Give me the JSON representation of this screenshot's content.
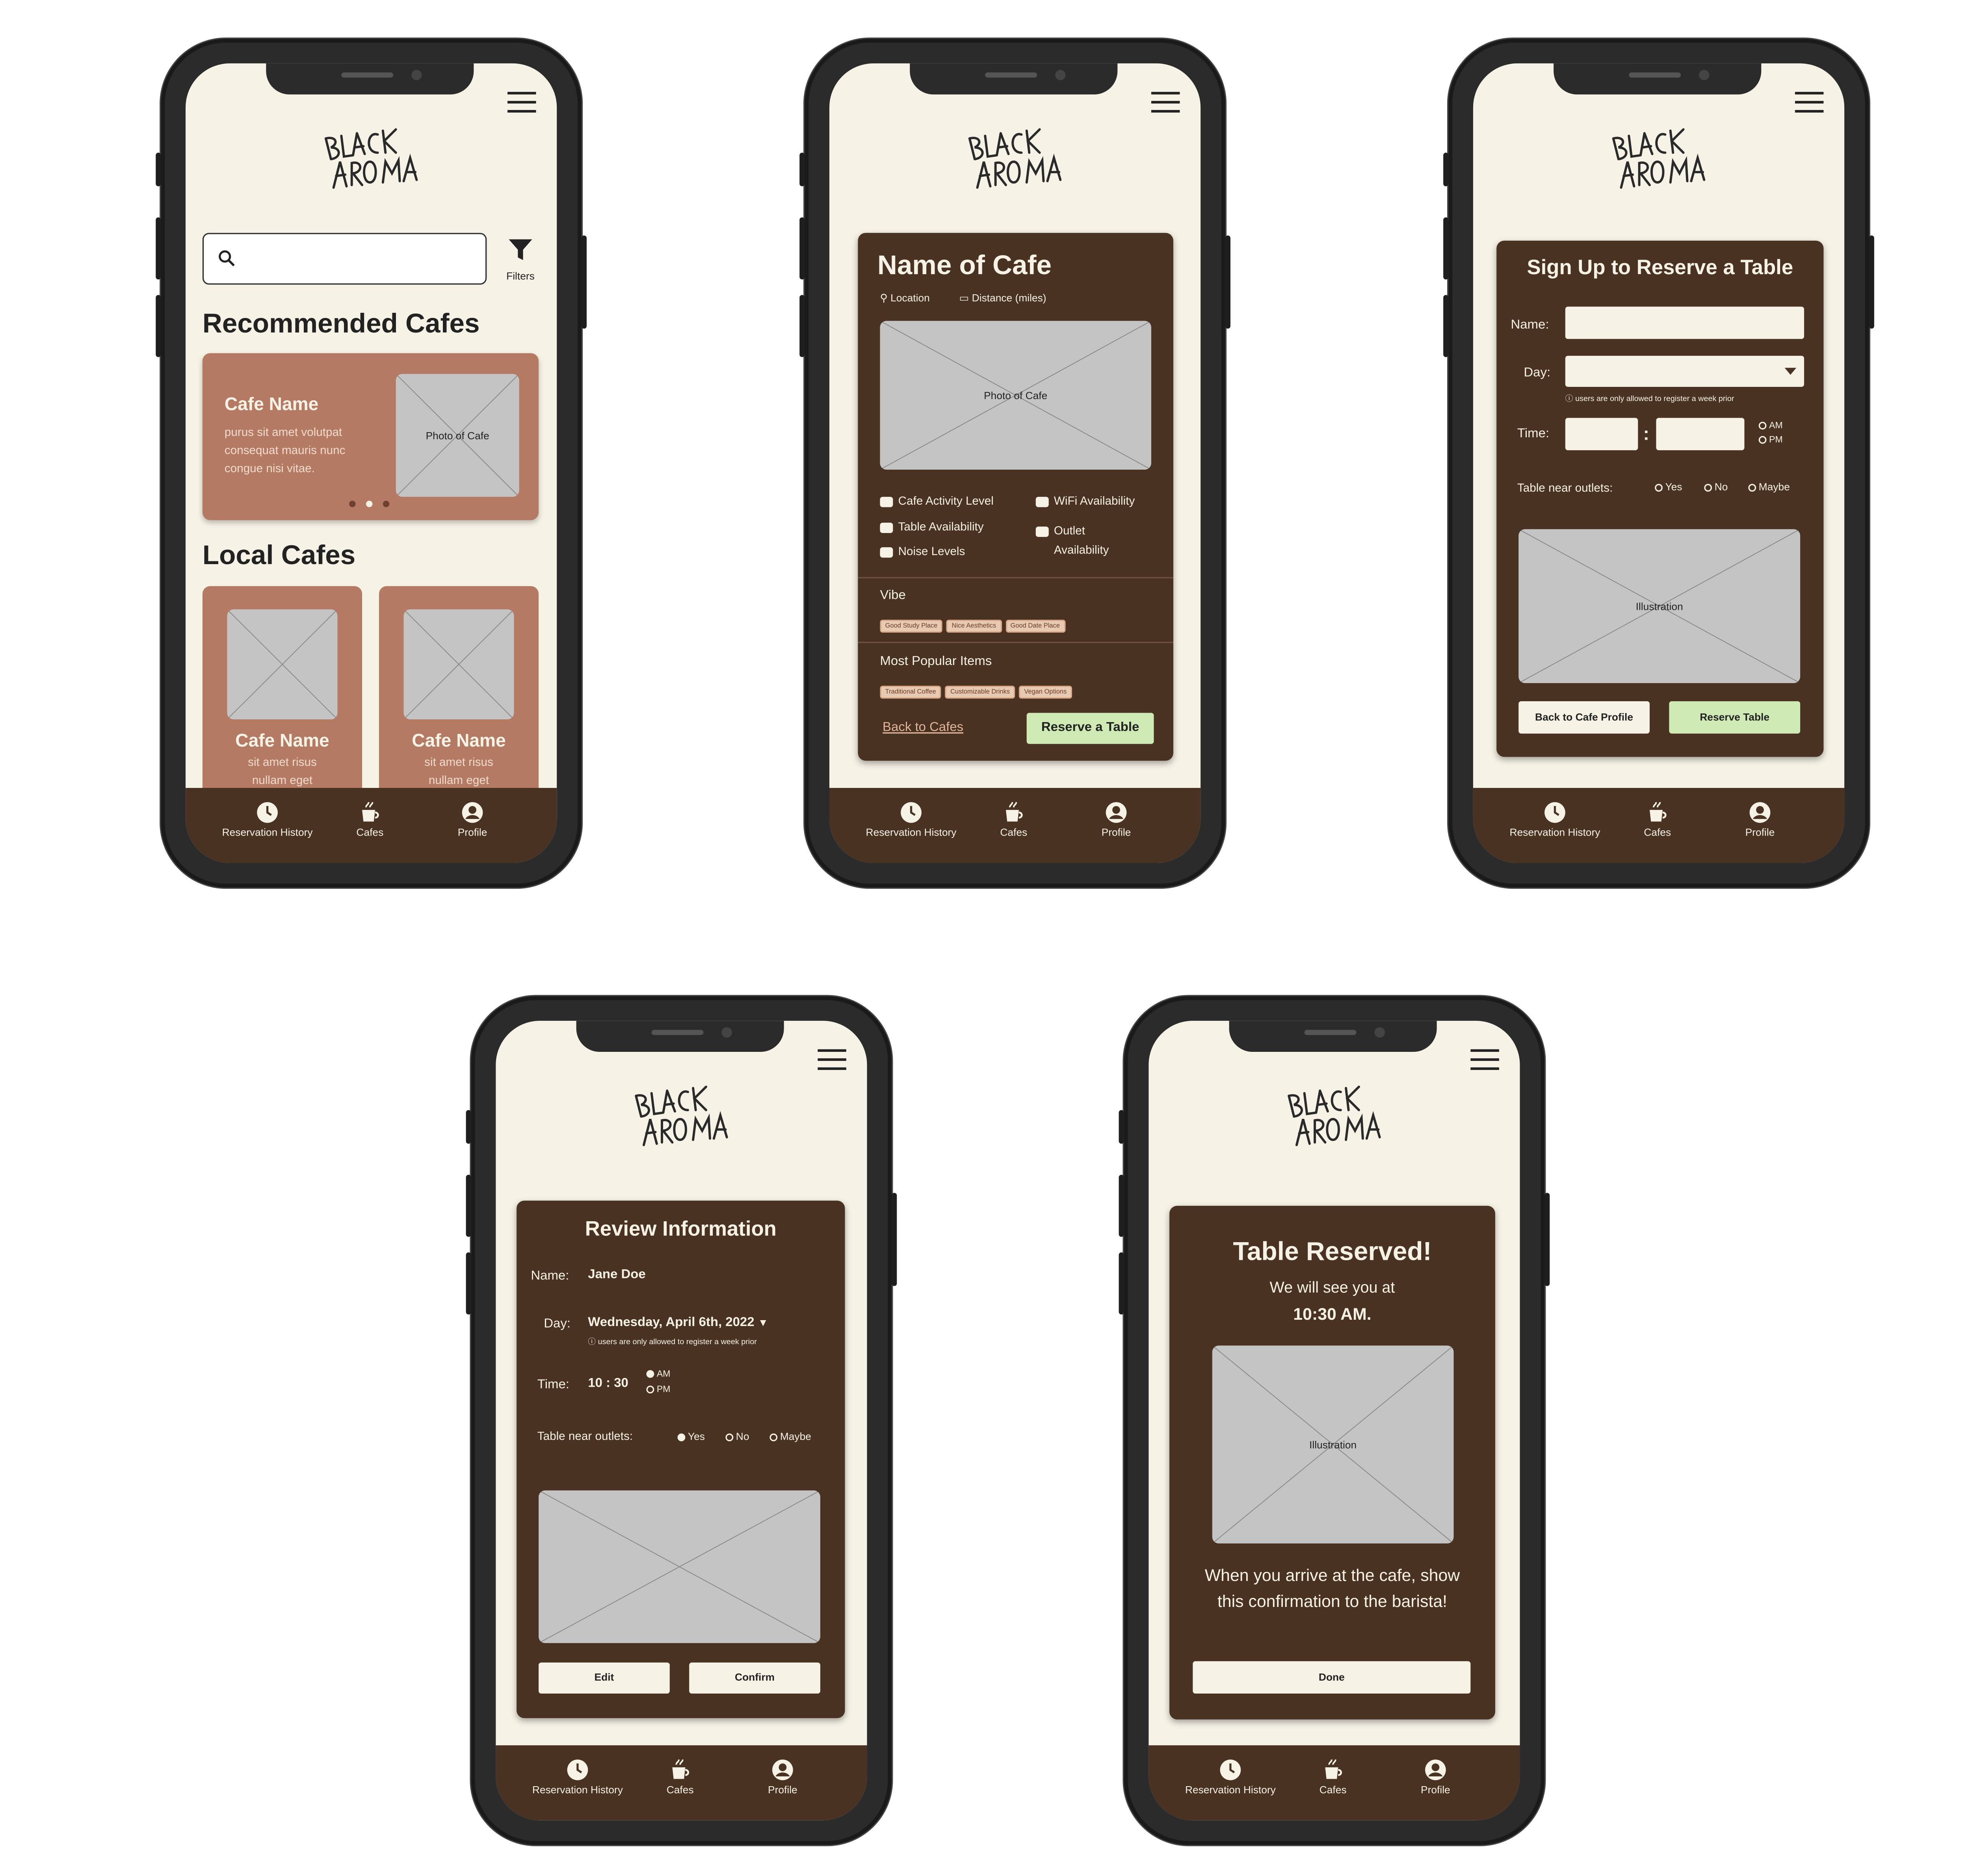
{
  "colors": {
    "dark_brown": "#4a3223",
    "light_brown": "#b57a63",
    "cream": "#f6f3e6",
    "green": "#cfeab4",
    "placeholder": "#c4c4c4"
  },
  "nav": {
    "history": "Reservation History",
    "cafes": "Cafes",
    "profile": "Profile"
  },
  "screen1": {
    "filters_label": "Filters",
    "recommended_heading": "Recommended Cafes",
    "featured": {
      "name": "Cafe Name",
      "desc": "purus sit amet volutpat consequat mauris nunc congue nisi vitae.",
      "photo": "Photo of Cafe"
    },
    "local_heading": "Local Cafes",
    "local": [
      {
        "name": "Cafe Name",
        "line1": "sit amet risus",
        "line2": "nullam eget"
      },
      {
        "name": "Cafe Name",
        "line1": "sit amet risus",
        "line2": "nullam eget"
      }
    ]
  },
  "screen2": {
    "title": "Name of Cafe",
    "location": "Location",
    "distance": "Distance (miles)",
    "photo": "Photo of Cafe",
    "features": {
      "activity": "Cafe Activity Level",
      "wifi": "WiFi Availability",
      "table": "Table Availability",
      "outlet_1": "Outlet",
      "outlet_2": "Availability",
      "noise": "Noise Levels"
    },
    "vibe_label": "Vibe",
    "vibe_tags": [
      "Good Study Place",
      "Nice Aesthetics",
      "Good Date Place"
    ],
    "popular_label": "Most Popular Items",
    "popular_tags": [
      "Traditional Coffee",
      "Customizable Drinks",
      "Vegan Options"
    ],
    "back_link": "Back to Cafes",
    "reserve_button": "Reserve a Table"
  },
  "screen3": {
    "title": "Sign Up to Reserve a Table",
    "name_label": "Name:",
    "day_label": "Day:",
    "day_note": "users are only allowed to register a week prior",
    "time_label": "Time:",
    "time_colon": ":",
    "am": "AM",
    "pm": "PM",
    "outlets_label": "Table near outlets:",
    "yes": "Yes",
    "no": "No",
    "maybe": "Maybe",
    "illustration": "Illustration",
    "back_button": "Back to Cafe Profile",
    "reserve_button": "Reserve Table"
  },
  "screen4": {
    "title": "Review Information",
    "name_label": "Name:",
    "name_value": "Jane Doe",
    "day_label": "Day:",
    "day_value": "Wednesday, April 6th, 2022",
    "day_note": "users are only allowed to register a week prior",
    "time_label": "Time:",
    "time_value": "10 : 30",
    "am": "AM",
    "pm": "PM",
    "outlets_label": "Table near outlets:",
    "yes": "Yes",
    "no": "No",
    "maybe": "Maybe",
    "edit_button": "Edit",
    "confirm_button": "Confirm"
  },
  "screen5": {
    "title": "Table Reserved!",
    "line1": "We will see you at",
    "line2": "10:30 AM.",
    "illustration": "Illustration",
    "message": "When you arrive at the cafe, show this confirmation to the barista!",
    "done_button": "Done"
  }
}
